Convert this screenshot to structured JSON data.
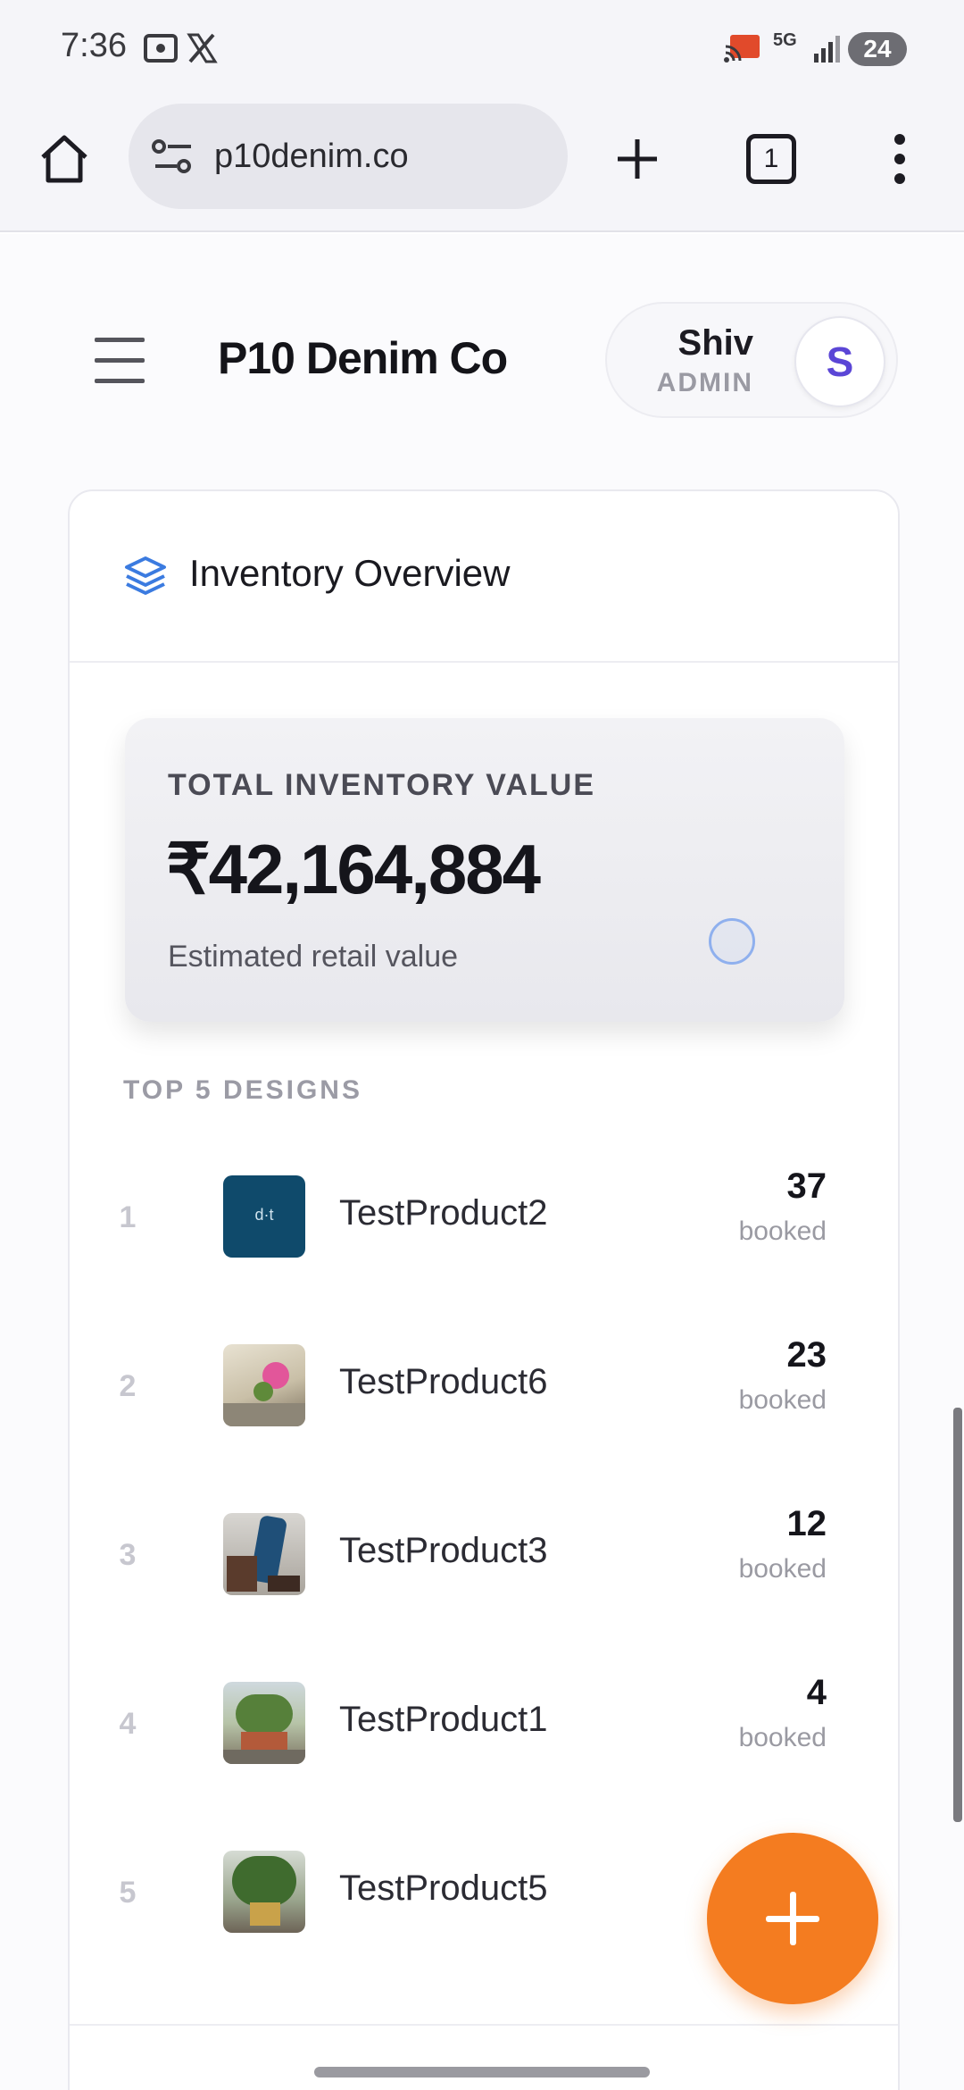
{
  "status_bar": {
    "time": "7:36",
    "network": "5G",
    "battery": "24",
    "icons": [
      "screen-record-icon",
      "x-logo-icon",
      "cast-icon",
      "signal-icon",
      "battery-icon"
    ]
  },
  "browser": {
    "url": "p10denim.co",
    "tab_count": "1",
    "icons": [
      "home-icon",
      "site-settings-icon",
      "new-tab-icon",
      "tab-switcher-icon",
      "overflow-menu-icon"
    ]
  },
  "header": {
    "brand": "P10 Denim Co",
    "user_name": "Shiv",
    "user_role": "ADMIN",
    "avatar_initial": "S"
  },
  "inventory": {
    "title": "Inventory Overview",
    "total_label": "TOTAL INVENTORY VALUE",
    "total_value": "₹42,164,884",
    "total_sub": "Estimated retail value",
    "top_label": "TOP 5 DESIGNS",
    "designs": [
      {
        "rank": "1",
        "name": "TestProduct2",
        "count": "37",
        "unit": "booked"
      },
      {
        "rank": "2",
        "name": "TestProduct6",
        "count": "23",
        "unit": "booked"
      },
      {
        "rank": "3",
        "name": "TestProduct3",
        "count": "12",
        "unit": "booked"
      },
      {
        "rank": "4",
        "name": "TestProduct1",
        "count": "4",
        "unit": "booked"
      },
      {
        "rank": "5",
        "name": "TestProduct5",
        "count": "",
        "unit": ""
      }
    ]
  },
  "colors": {
    "accent_orange": "#f47c20",
    "avatar_text": "#5b46d6",
    "layers_icon": "#3b7be0"
  }
}
